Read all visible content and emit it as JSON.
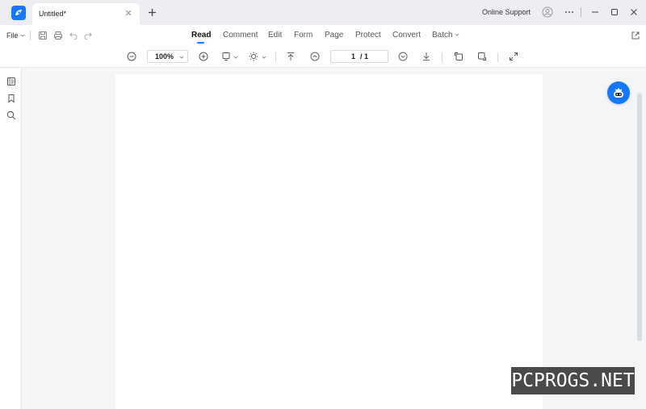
{
  "titlebar": {
    "tab_title": "Untitled*",
    "online_support": "Online Support",
    "icons": [
      "app-logo-icon",
      "close-icon",
      "plus-icon",
      "user-icon",
      "more-icon",
      "minimize-icon",
      "maximize-icon",
      "close-window-icon"
    ]
  },
  "menu": {
    "file_label": "File",
    "items": [
      {
        "label": "Read",
        "active": true
      },
      {
        "label": "Comment"
      },
      {
        "label": "Edit"
      },
      {
        "label": "Form"
      },
      {
        "label": "Page"
      },
      {
        "label": "Protect"
      },
      {
        "label": "Convert"
      },
      {
        "label": "Batch"
      }
    ]
  },
  "toolbar": {
    "zoom_value": "100%",
    "page_current": "1",
    "page_total": "/ 1"
  },
  "watermark": {
    "text": "PCPROGS.NET"
  },
  "colors": {
    "accent": "#1677ff",
    "titlebar_bg": "#eceef1",
    "canvas_bg": "#f4f5f7"
  }
}
